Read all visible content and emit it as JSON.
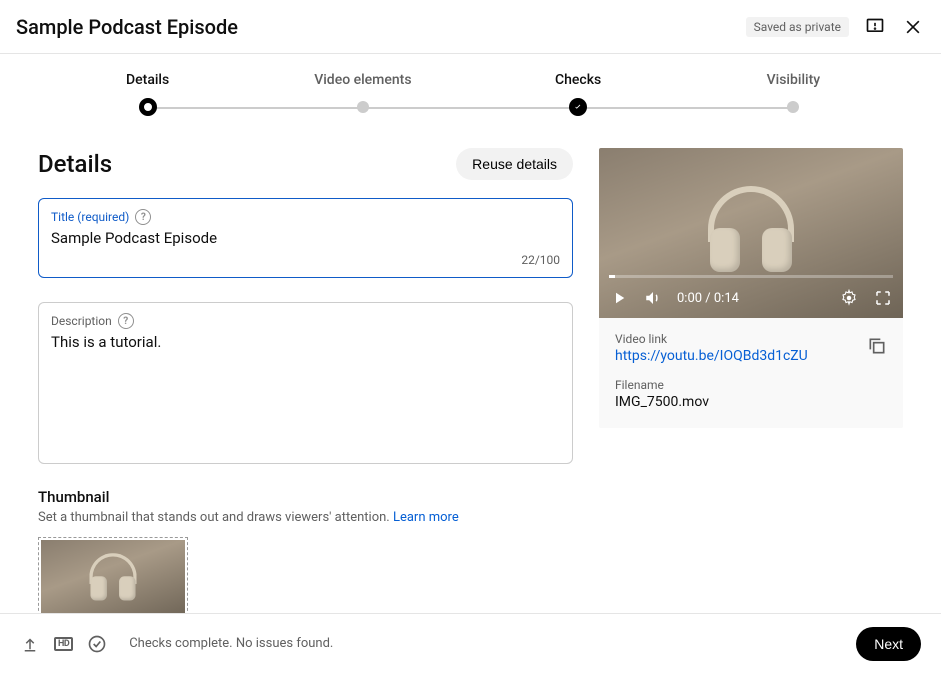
{
  "header": {
    "title": "Sample Podcast Episode",
    "saved_label": "Saved as private"
  },
  "stepper": {
    "steps": [
      {
        "label": "Details"
      },
      {
        "label": "Video elements"
      },
      {
        "label": "Checks"
      },
      {
        "label": "Visibility"
      }
    ]
  },
  "details": {
    "section_title": "Details",
    "reuse_label": "Reuse details",
    "title_field_label": "Title (required)",
    "title_value": "Sample Podcast Episode",
    "title_counter": "22/100",
    "desc_field_label": "Description",
    "desc_value": "This is a tutorial."
  },
  "thumbnail": {
    "title": "Thumbnail",
    "subtitle_prefix": "Set a thumbnail that stands out and draws viewers' attention. ",
    "learn_more": "Learn more"
  },
  "video": {
    "time_display": "0:00 / 0:14",
    "link_label": "Video link",
    "link_value": "https://youtu.be/IOQBd3d1cZU",
    "filename_label": "Filename",
    "filename_value": "IMG_7500.mov"
  },
  "footer": {
    "status": "Checks complete. No issues found.",
    "next_label": "Next",
    "hd_label": "HD"
  }
}
